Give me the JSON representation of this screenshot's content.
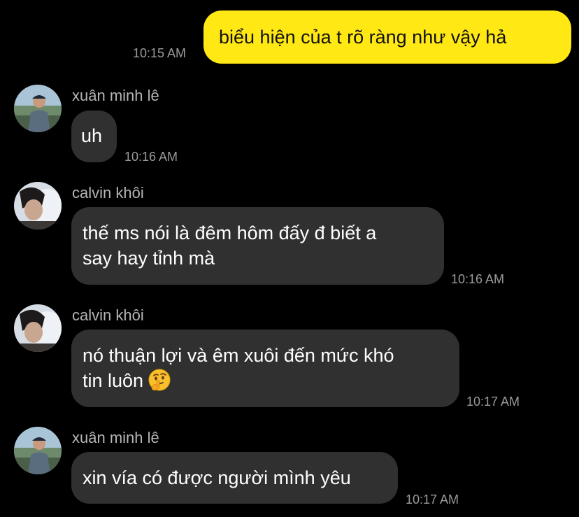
{
  "messages": [
    {
      "direction": "outgoing",
      "text": "biểu hiện của t rõ ràng như vậy hả",
      "time": "10:15 AM"
    },
    {
      "direction": "incoming",
      "sender": "xuân minh lê",
      "avatar": "avatar-xuan-minh-le",
      "text": "uh",
      "time": "10:16 AM"
    },
    {
      "direction": "incoming",
      "sender": "calvin khôi",
      "avatar": "avatar-calvin-khoi",
      "text_lines": [
        "thế ms nói là đêm hôm đấy đ biết a",
        "say hay tỉnh mà"
      ],
      "time": "10:16 AM"
    },
    {
      "direction": "incoming",
      "sender": "calvin khôi",
      "avatar": "avatar-calvin-khoi",
      "text_lines": [
        "nó thuận lợi và êm xuôi đến mức khó",
        "tin luôn"
      ],
      "emoji": "thinking-face-icon",
      "time": "10:17 AM"
    },
    {
      "direction": "incoming",
      "sender": "xuân minh lê",
      "avatar": "avatar-xuan-minh-le",
      "text": "xin vía có được người mình yêu",
      "time": "10:17 AM"
    }
  ],
  "colors": {
    "background": "#000000",
    "outgoing_bubble": "#ffe814",
    "incoming_bubble": "#303030",
    "timestamp": "#9a9a9a",
    "sender_name": "#b5b5b5"
  }
}
